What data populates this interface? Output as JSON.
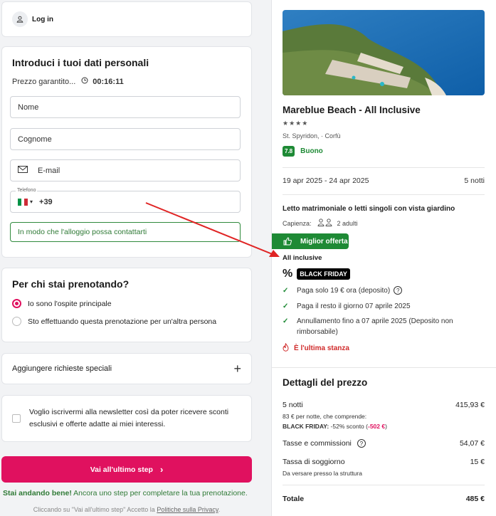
{
  "login": {
    "label": "Log in"
  },
  "personal": {
    "title": "Introduci i tuoi dati personali",
    "price_guaranteed": "Prezzo garantito...",
    "timer": "00:16:11",
    "first_name_placeholder": "Nome",
    "last_name_placeholder": "Cognome",
    "email_placeholder": "E-mail",
    "phone_label": "Telefono",
    "phone_prefix": "+39",
    "contact_hint": "In modo che l'alloggio possa contattarti"
  },
  "booking_for": {
    "title": "Per chi stai prenotando?",
    "options": [
      {
        "label": "Io sono l'ospite principale",
        "selected": true
      },
      {
        "label": "Sto effettuando questa prenotazione per un'altra persona",
        "selected": false
      }
    ]
  },
  "special_requests": {
    "label": "Aggiungere richieste speciali"
  },
  "newsletter": {
    "text": "Voglio iscrivermi alla newsletter così da poter ricevere sconti esclusivi e offerte adatte ai miei interessi."
  },
  "cta": {
    "label": "Vai all'ultimo step"
  },
  "progress": {
    "bold": "Stai andando bene!",
    "rest": " Ancora uno step per completare la tua prenotazione."
  },
  "privacy": {
    "prefix": "Cliccando su \"Vai all'ultimo step\" Accetto la ",
    "link": "Politiche sulla Privacy",
    "suffix": "."
  },
  "hotel": {
    "name": "Mareblue Beach - All Inclusive",
    "stars": "★★★★",
    "location": "St. Spyridon, · Corfù",
    "rating_score": "7.8",
    "rating_label": "Buono",
    "dates": "19 apr 2025 - 24 apr 2025",
    "nights": "5 notti",
    "room": "Letto matrimoniale o letti singoli con vista giardino",
    "capacity_label": "Capienza:",
    "capacity_value": "2 adulti",
    "best_offer": "Miglior offerta",
    "board": "All inclusive",
    "promo_tag": "BLACK FRIDAY",
    "conditions": [
      "Paga solo 19 € ora (deposito)",
      "Paga il resto il giorno 07 aprile 2025",
      "Annullamento fino a 07 aprile 2025 (Deposito non rimborsabile)"
    ],
    "last_room": "È l'ultima stanza"
  },
  "price": {
    "title": "Dettagli del prezzo",
    "nights_label": "5 notti",
    "nights_value": "415,93 €",
    "per_night": "83 € per notte, che comprende:",
    "bf_prefix": "BLACK FRIDAY:",
    "bf_mid": " -52% sconto (",
    "bf_value": "-502 €",
    "bf_suffix": ")",
    "taxes_label": "Tasse e commissioni",
    "taxes_value": "54,07 €",
    "city_tax_label": "Tassa di soggiorno",
    "city_tax_value": "15 €",
    "city_tax_note": "Da versare presso la struttura",
    "total_label": "Totale",
    "total_value": "485 €"
  },
  "colors": {
    "accent": "#e0115f",
    "green": "#1e8a35",
    "warning": "#d02b2b"
  }
}
